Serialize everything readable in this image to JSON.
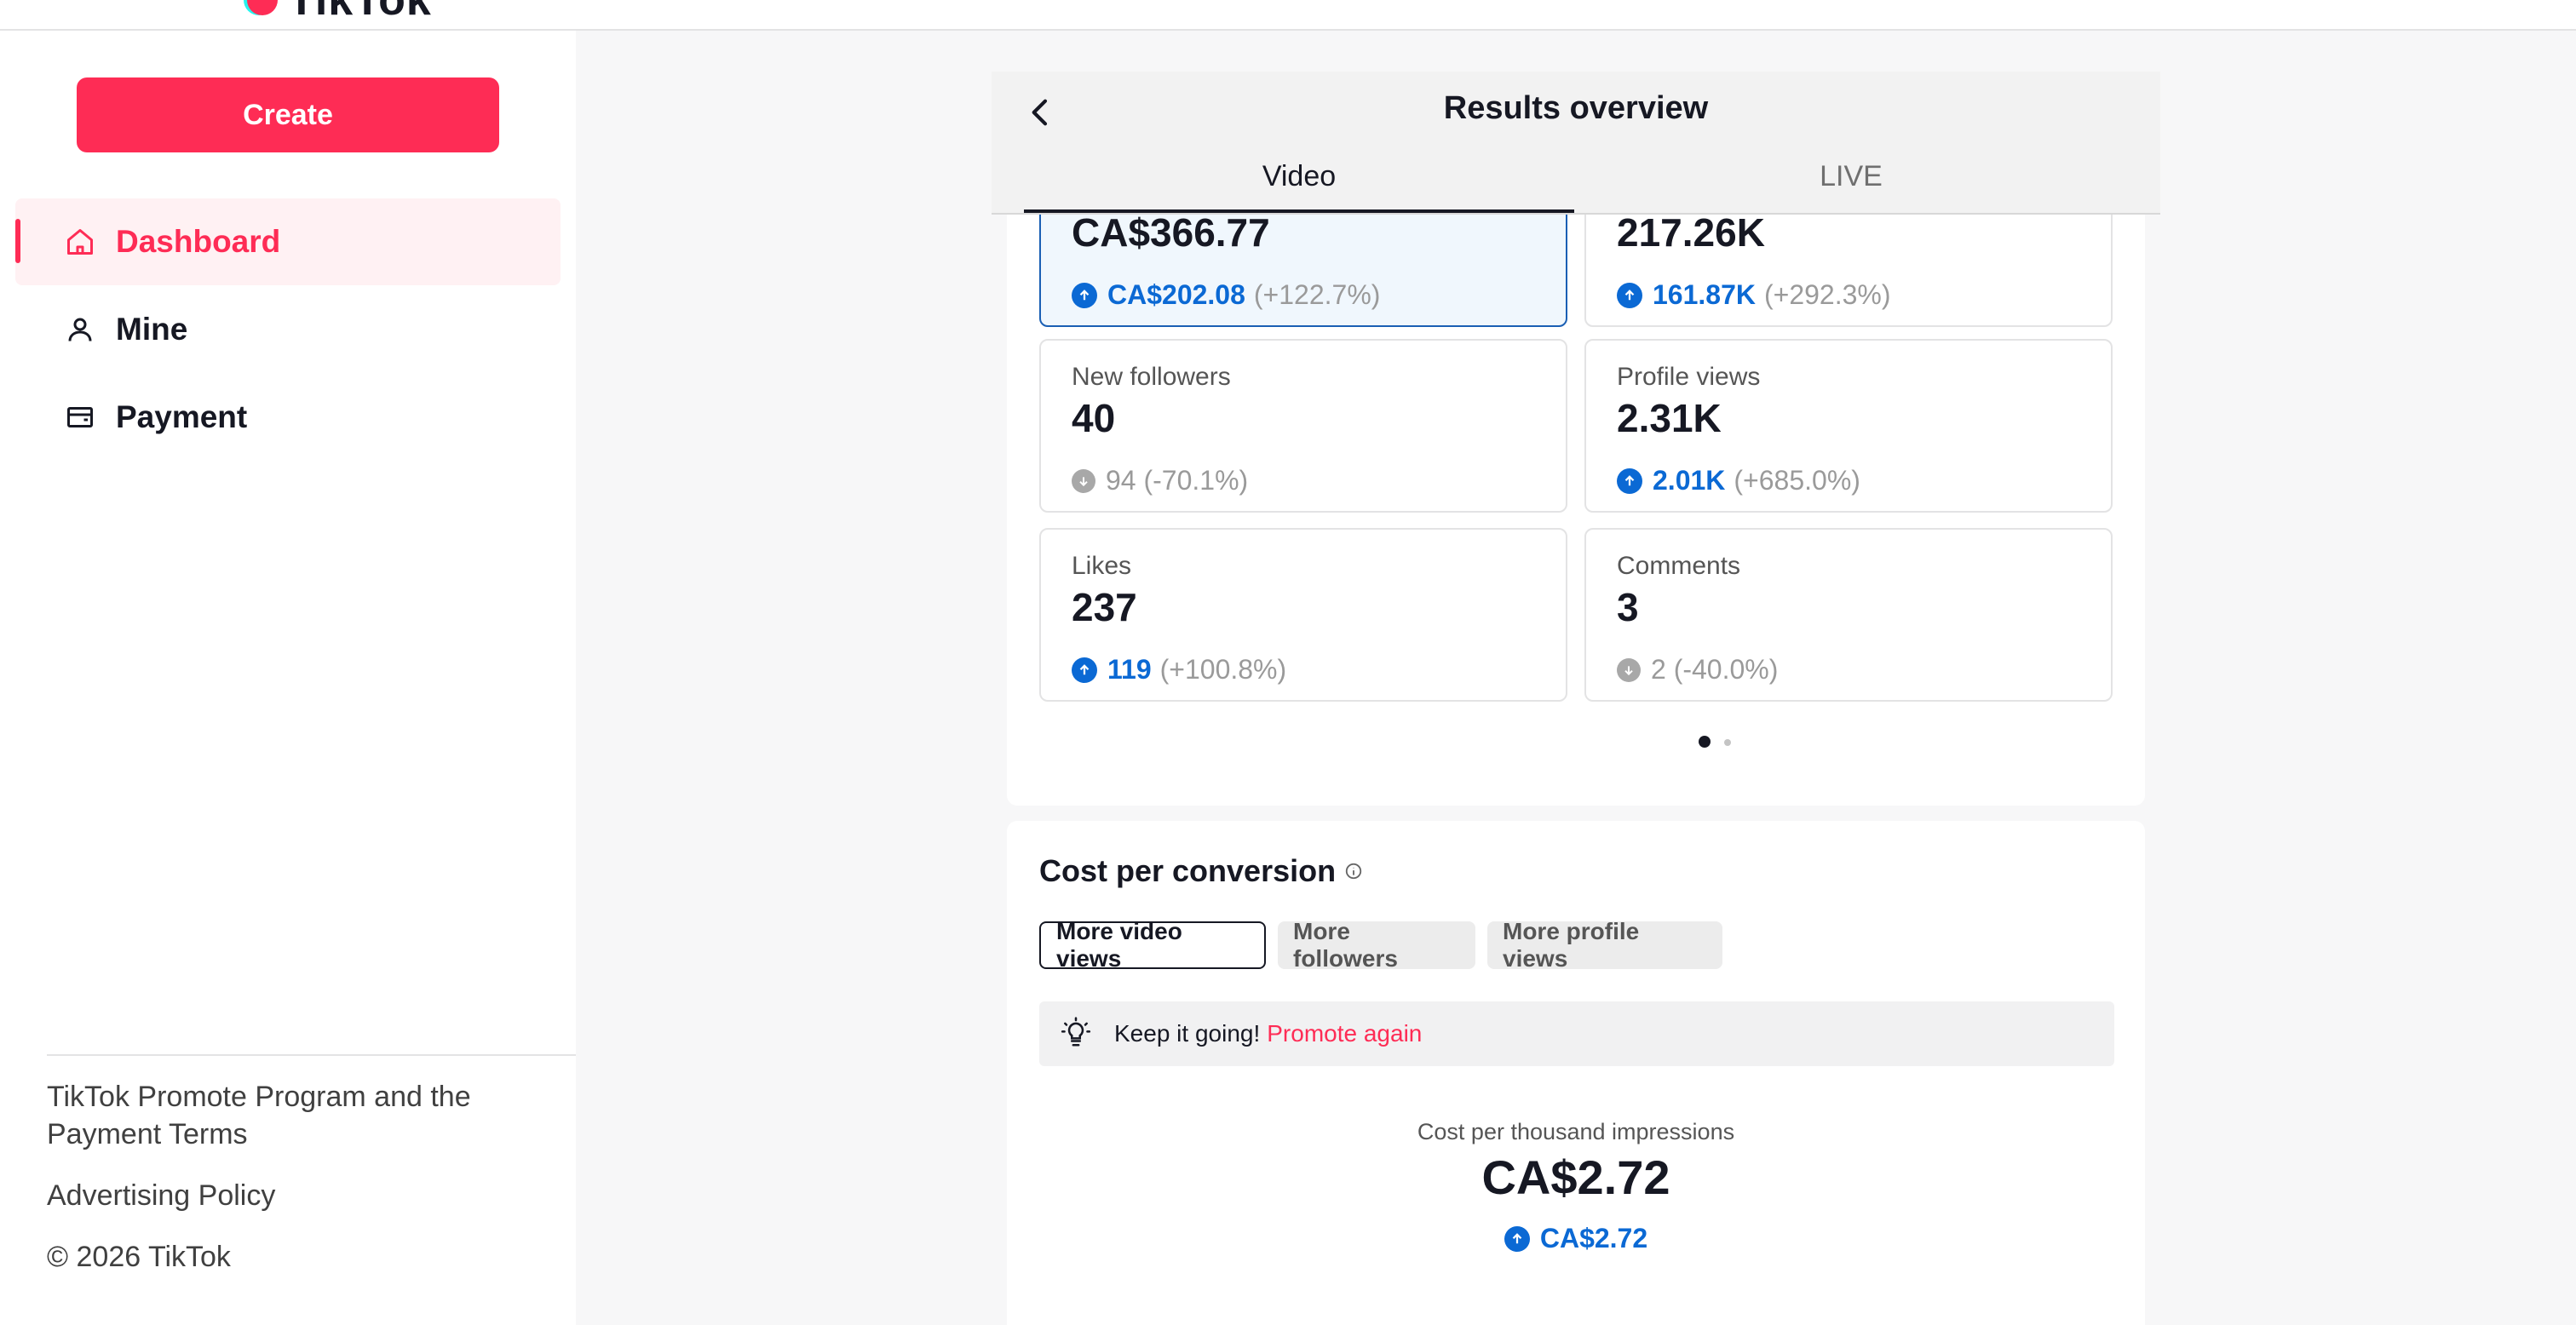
{
  "header": {
    "logo_text": "TikTok"
  },
  "sidebar": {
    "create_label": "Create",
    "items": [
      {
        "label": "Dashboard",
        "icon": "home-icon",
        "active": true
      },
      {
        "label": "Mine",
        "icon": "user-icon",
        "active": false
      },
      {
        "label": "Payment",
        "icon": "wallet-icon",
        "active": false
      }
    ],
    "footer": {
      "program_terms": "TikTok Promote Program and the Payment Terms",
      "advertising_policy": "Advertising Policy",
      "copyright": "© 2026 TikTok"
    }
  },
  "panel": {
    "title": "Results overview",
    "tabs": [
      {
        "label": "Video",
        "active": true
      },
      {
        "label": "LIVE",
        "active": false
      }
    ],
    "metrics": [
      {
        "label": "",
        "value": "CA$366.77",
        "change": "CA$202.08",
        "pct": "(+122.7%)",
        "direction": "up",
        "selected": true
      },
      {
        "label": "",
        "value": "217.26K",
        "change": "161.87K",
        "pct": "(+292.3%)",
        "direction": "up",
        "selected": false
      },
      {
        "label": "New followers",
        "value": "40",
        "change": "94 (-70.1%)",
        "pct": "",
        "direction": "down",
        "selected": false
      },
      {
        "label": "Profile views",
        "value": "2.31K",
        "change": "2.01K",
        "pct": "(+685.0%)",
        "direction": "up",
        "selected": false
      },
      {
        "label": "Likes",
        "value": "237",
        "change": "119",
        "pct": "(+100.8%)",
        "direction": "up",
        "selected": false
      },
      {
        "label": "Comments",
        "value": "3",
        "change": "2 (-40.0%)",
        "pct": "",
        "direction": "down",
        "selected": false
      }
    ],
    "pagination": {
      "pages": 2,
      "current": 1
    }
  },
  "cost_per_conversion": {
    "title": "Cost per conversion",
    "chips": [
      {
        "label": "More video views",
        "selected": true
      },
      {
        "label": "More followers",
        "selected": false
      },
      {
        "label": "More profile views",
        "selected": false
      }
    ],
    "promo_text": "Keep it going!",
    "promo_link": "Promote again",
    "cpm_label": "Cost per thousand impressions",
    "cpm_value": "CA$2.72",
    "cpm_change": "CA$2.72"
  },
  "colors": {
    "accent": "#fe2c55",
    "up": "#0b69d4",
    "neutral": "#9a9a9a"
  }
}
